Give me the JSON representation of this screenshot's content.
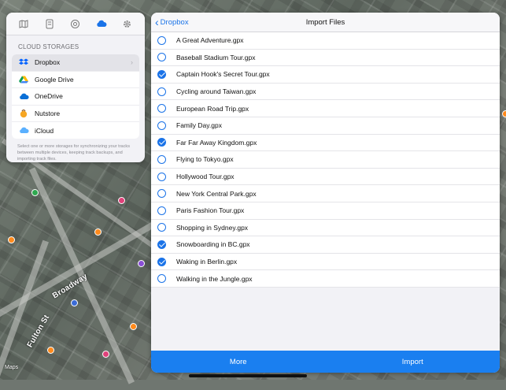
{
  "colors": {
    "accent": "#1a73e8",
    "footer": "#1a7ff0",
    "panel_bg": "#f2f2f6"
  },
  "toolbar": {
    "tabs": [
      {
        "name": "map-icon"
      },
      {
        "name": "device-icon"
      },
      {
        "name": "settings-dial-icon"
      },
      {
        "name": "cloud-icon",
        "active": true
      },
      {
        "name": "gear-icon"
      }
    ]
  },
  "cloud": {
    "section_title": "CLOUD STORAGES",
    "storages": [
      {
        "label": "Dropbox",
        "icon": "dropbox-icon",
        "selected": true
      },
      {
        "label": "Google Drive",
        "icon": "google-drive-icon"
      },
      {
        "label": "OneDrive",
        "icon": "onedrive-icon"
      },
      {
        "label": "Nutstore",
        "icon": "nutstore-icon"
      },
      {
        "label": "iCloud",
        "icon": "icloud-icon"
      }
    ],
    "note": "Select one or more storages for synchronizing your tracks between multiple devices, keeping track backups, and importing track files."
  },
  "import": {
    "back_label": "Dropbox",
    "title": "Import Files",
    "files": [
      {
        "name": "A Great Adventure.gpx",
        "checked": false
      },
      {
        "name": "Baseball Stadium Tour.gpx",
        "checked": false
      },
      {
        "name": "Captain Hook's Secret Tour.gpx",
        "checked": true
      },
      {
        "name": "Cycling around Taiwan.gpx",
        "checked": false
      },
      {
        "name": "European Road Trip.gpx",
        "checked": false
      },
      {
        "name": "Family Day.gpx",
        "checked": false
      },
      {
        "name": "Far Far Away Kingdom.gpx",
        "checked": true
      },
      {
        "name": "Flying to Tokyo.gpx",
        "checked": false
      },
      {
        "name": "Hollywood Tour.gpx",
        "checked": false
      },
      {
        "name": "New York Central Park.gpx",
        "checked": false
      },
      {
        "name": "Paris Fashion Tour.gpx",
        "checked": false
      },
      {
        "name": "Shopping in Sydney.gpx",
        "checked": false
      },
      {
        "name": "Snowboarding in BC.gpx",
        "checked": true
      },
      {
        "name": "Waking in Berlin.gpx",
        "checked": true
      },
      {
        "name": "Walking in the Jungle.gpx",
        "checked": false
      }
    ],
    "more_label": "More",
    "import_label": "Import"
  },
  "map": {
    "street_label": "Broadway",
    "street_label_2": "Fulton St",
    "maps_logo": "Maps"
  }
}
